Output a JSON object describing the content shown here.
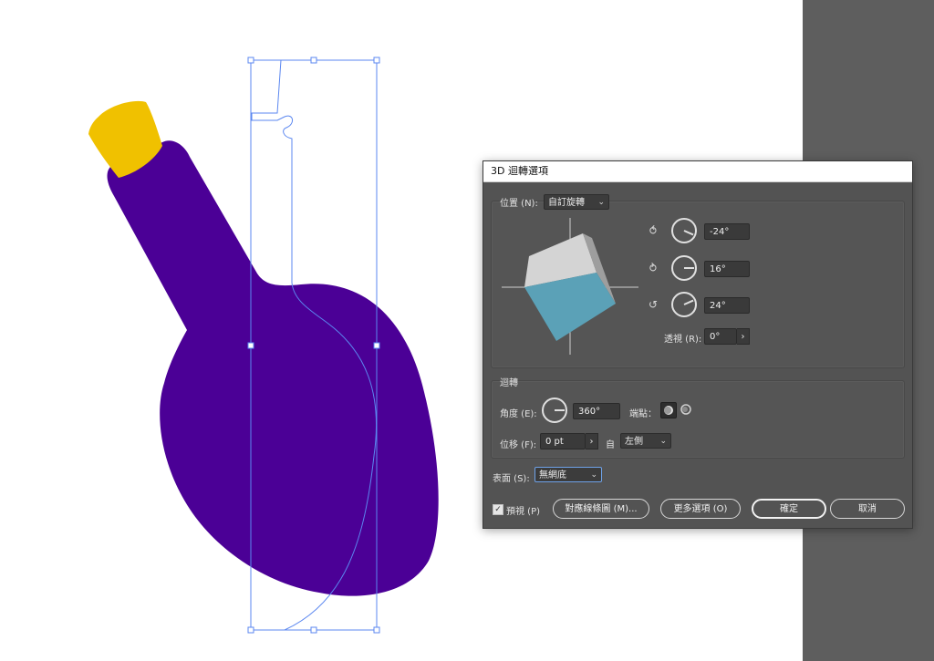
{
  "colors": {
    "bottle": "#4b0096",
    "cork": "#f0c100",
    "path": "#5b87f0",
    "cube_front": "#5ba1b7",
    "cube_top": "#d4d4d4",
    "cube_side": "#9e9e9e",
    "pasteboard": "#5e5e5e",
    "dialog_bg": "#535353"
  },
  "dialog": {
    "title": "3D 迴轉選項",
    "position_label": "位置 (N):",
    "position_value": "自訂旋轉",
    "axis_x_icon": "rotate-x-icon",
    "axis_y_icon": "rotate-y-icon",
    "axis_z_icon": "rotate-z-icon",
    "rot_x": "-24°",
    "rot_y": "16°",
    "rot_z": "24°",
    "perspective_label": "透視 (R):",
    "perspective_value": "0°",
    "revolve_section": "迴轉",
    "angle_label": "角度 (E):",
    "angle_value": "360°",
    "cap_label": "端點：",
    "offset_label": "位移 (F):",
    "offset_value": "0 pt",
    "from_label": "自",
    "from_value": "左側",
    "surface_label": "表面 (S):",
    "surface_value": "無網底",
    "preview_label": "預視 (P)",
    "preview_checked": true,
    "map_art_button": "對應線條圖 (M)...",
    "more_options_button": "更多選項 (O)",
    "ok_button": "確定",
    "cancel_button": "取消"
  }
}
